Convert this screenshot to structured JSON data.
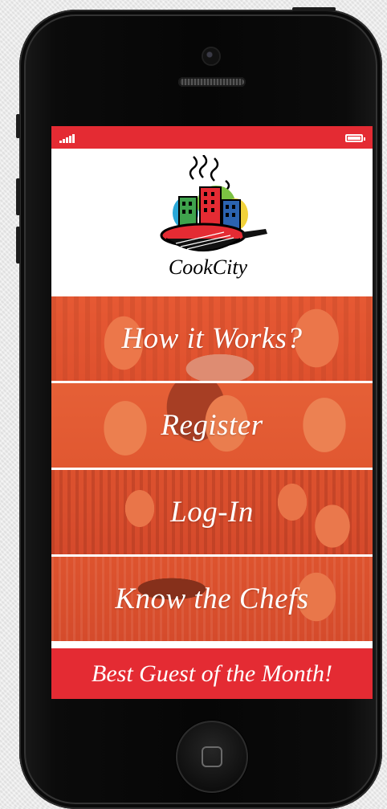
{
  "status_bar": {
    "signal_icon": "signal-bars-icon",
    "battery_icon": "battery-icon"
  },
  "logo": {
    "text": "CookCity"
  },
  "menu": {
    "items": [
      {
        "label": "How it Works?"
      },
      {
        "label": "Register"
      },
      {
        "label": "Log-In"
      },
      {
        "label": "Know the Chefs"
      }
    ],
    "best_guest_label": "Best Guest of the Month!"
  },
  "colors": {
    "brand_red": "#e42b33",
    "overlay_orange": "#e2582f"
  }
}
